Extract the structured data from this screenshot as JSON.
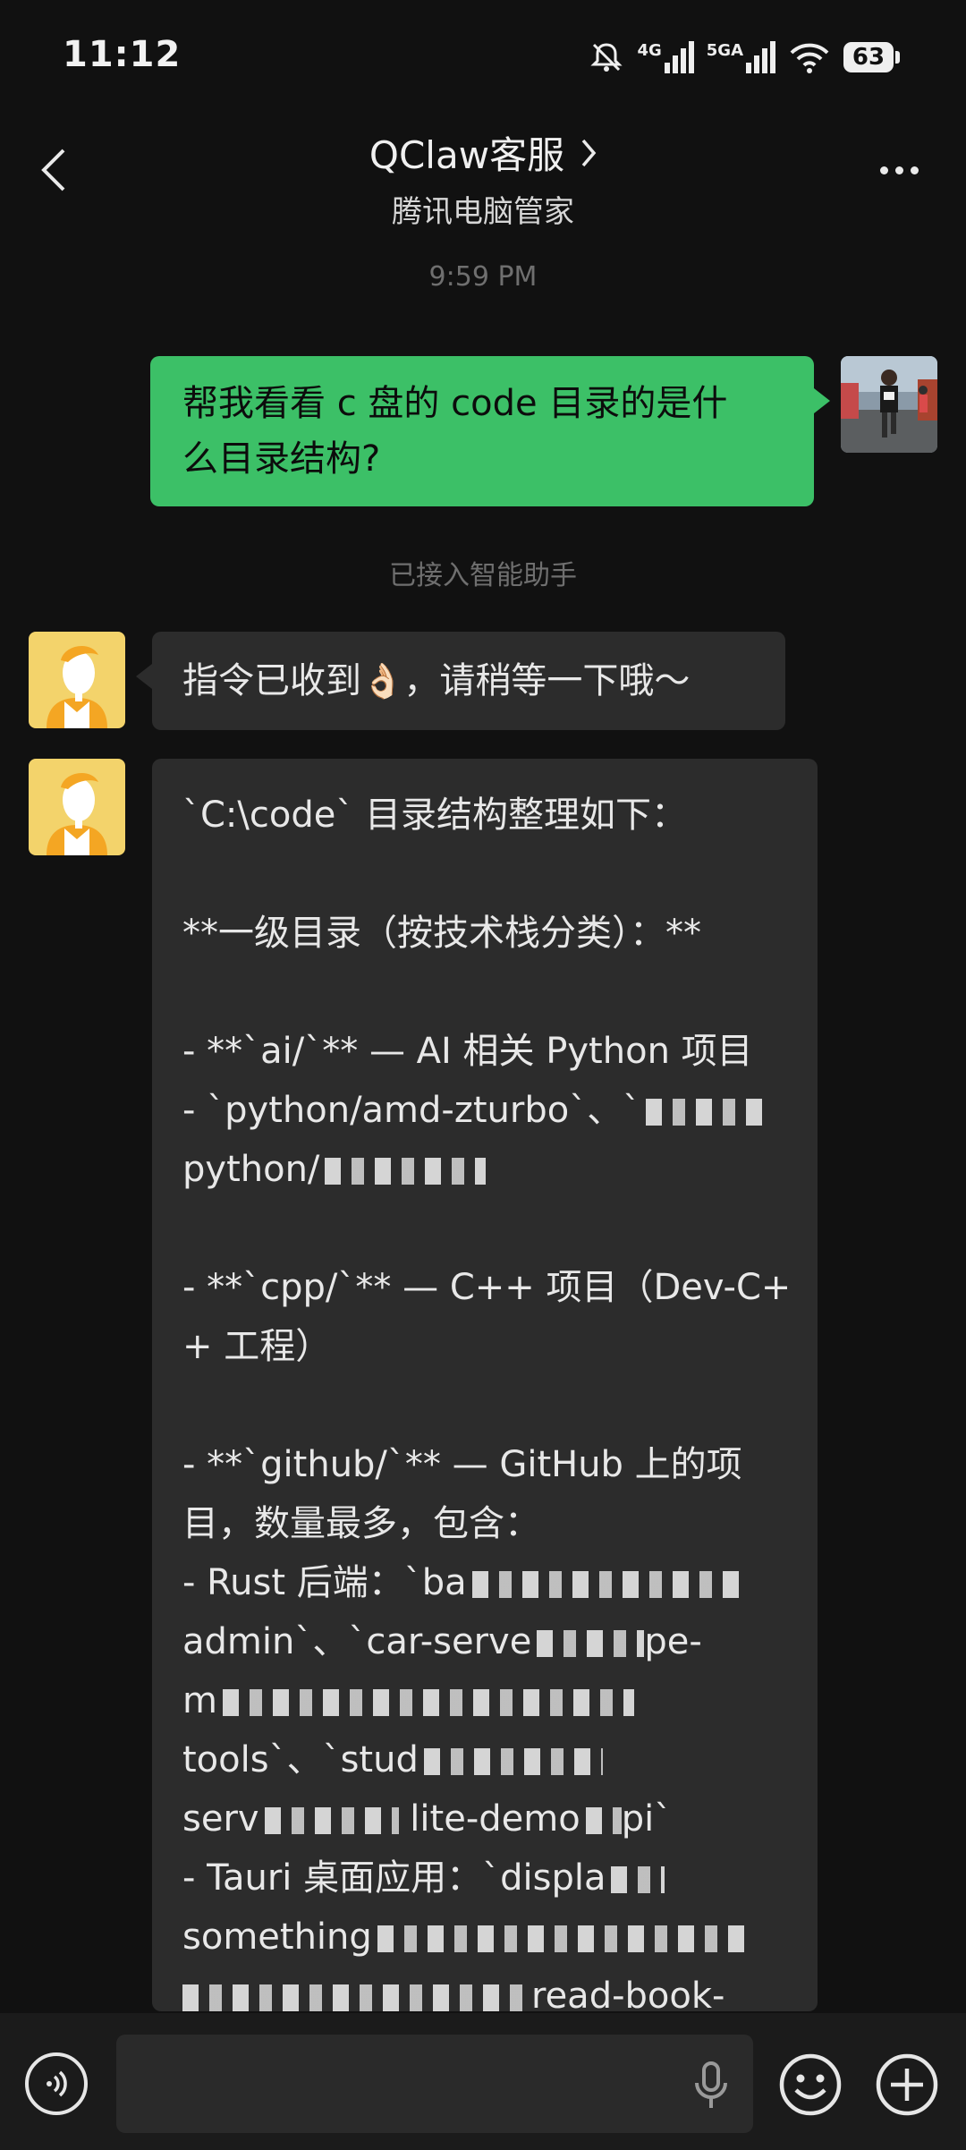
{
  "status_bar": {
    "time": "11:12",
    "battery": "63",
    "network_1": "4G",
    "network_2": "5GA"
  },
  "header": {
    "title": "QClaw客服",
    "subtitle": "腾讯电脑管家"
  },
  "timestamp": "9:59 PM",
  "system_note": "已接入智能助手",
  "messages": {
    "outgoing": {
      "line1": "帮我看看 c 盘的 code 目录的是什",
      "line2": "么目录结构?"
    },
    "ack": {
      "text_before": "指令已收到",
      "emoji": "👌🏻",
      "text_after": "，请稍等一下哦～"
    },
    "reply": {
      "lines": [
        "`C:\\code` 目录结构整理如下：",
        "",
        "**一级目录（按技术栈分类）：**",
        "",
        "- **`ai/`** — AI 相关 Python 项目",
        "  - `python/amd-zturbo`、`",
        "python/",
        "",
        "- **`cpp/`** — C++ 项目（Dev-C+",
        "+ 工程）",
        "",
        "- **`github/`** — GitHub 上的项",
        "目，数量最多，包含：",
        "  - Rust 后端：`ba",
        "admin`、`car-serve",
        "m",
        "tools`、`stud",
        "serv",
        "  - Tauri 桌面应用：`displa",
        "something",
        "",
        "read-book-"
      ],
      "extra_visible": {
        "pe_fragment": "pe-",
        "lite_demo_fragment": "lite-demo",
        "pi_fragment": "pi`"
      }
    }
  },
  "input": {
    "value": "",
    "placeholder": ""
  },
  "icons": {
    "back": "chevron-left-icon",
    "title_arrow": "chevron-right-icon",
    "more": "more-dots-icon",
    "voice": "voice-icon",
    "mic": "microphone-icon",
    "emoji": "emoji-icon",
    "plus": "plus-icon"
  },
  "colors": {
    "background": "#111111",
    "outgoing_bubble": "#3cc067",
    "incoming_bubble": "#2c2c2c",
    "bot_avatar_bg": "#f3d36b"
  }
}
